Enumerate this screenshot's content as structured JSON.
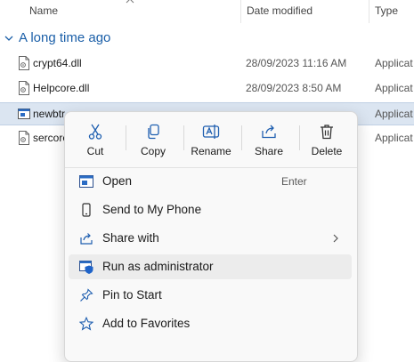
{
  "columns": {
    "name": "Name",
    "date_modified": "Date modified",
    "type": "Type"
  },
  "group": {
    "label": "A long time ago"
  },
  "files": [
    {
      "name": "crypt64.dll",
      "date": "28/09/2023 11:16 AM",
      "type": "Applicat",
      "selected": false
    },
    {
      "name": "Helpcore.dll",
      "date": "28/09/2023 8:50 AM",
      "type": "Applicat",
      "selected": false
    },
    {
      "name": "newbtr",
      "date": "",
      "type": "Applicat",
      "selected": true
    },
    {
      "name": "sercore",
      "date": "",
      "type": "Applicat",
      "selected": false
    }
  ],
  "quick_actions": [
    {
      "label": "Cut",
      "icon": "cut-icon"
    },
    {
      "label": "Copy",
      "icon": "copy-icon"
    },
    {
      "label": "Rename",
      "icon": "rename-icon"
    },
    {
      "label": "Share",
      "icon": "share-icon"
    },
    {
      "label": "Delete",
      "icon": "delete-icon"
    }
  ],
  "menu_items": [
    {
      "label": "Open",
      "shortcut": "Enter",
      "icon": "open-icon"
    },
    {
      "label": "Send to My Phone",
      "shortcut": "",
      "icon": "phone-icon"
    },
    {
      "label": "Share with",
      "shortcut": "",
      "icon": "share-with-icon",
      "submenu": true
    },
    {
      "label": "Run as administrator",
      "shortcut": "",
      "icon": "shield-icon",
      "hover": true
    },
    {
      "label": "Pin to Start",
      "shortcut": "",
      "icon": "pin-icon"
    },
    {
      "label": "Add to Favorites",
      "shortcut": "",
      "icon": "star-icon"
    }
  ],
  "colors": {
    "accent": "#1b5fa8",
    "selection": "#dbe5f1",
    "menu_bg": "#f9f9f9",
    "hover": "#ececec"
  }
}
